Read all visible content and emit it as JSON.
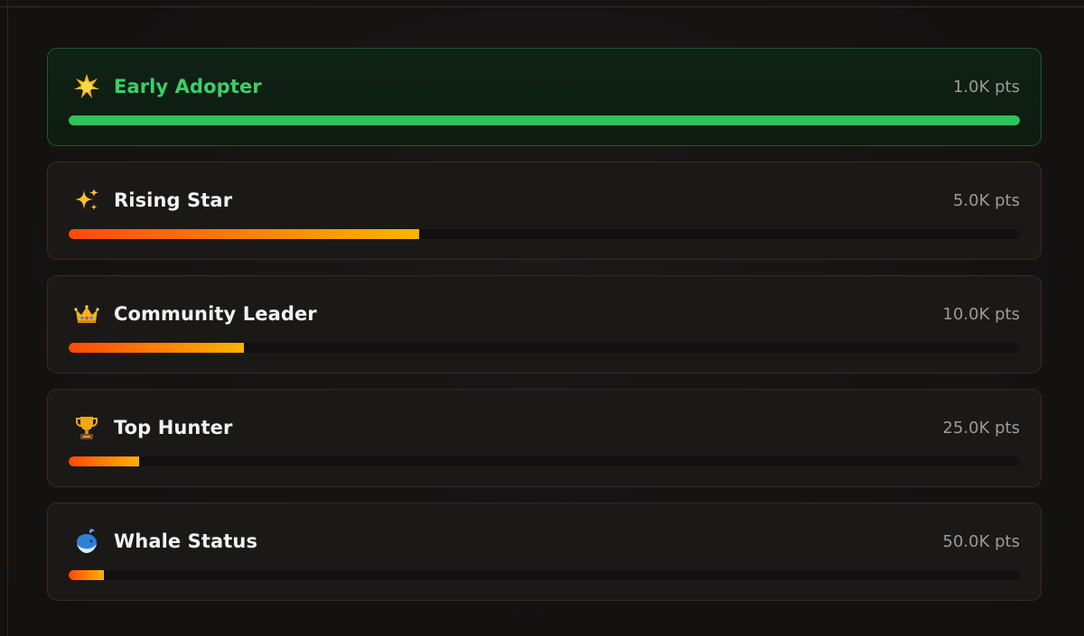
{
  "achievements": [
    {
      "title": "Early Adopter",
      "points": "1.0K pts",
      "progress_percent": 100,
      "icon": "glowing-star-icon",
      "completed": true
    },
    {
      "title": "Rising Star",
      "points": "5.0K pts",
      "progress_percent": 36.8,
      "icon": "sparkles-icon",
      "completed": false
    },
    {
      "title": "Community Leader",
      "points": "10.0K pts",
      "progress_percent": 18.4,
      "icon": "crown-icon",
      "completed": false
    },
    {
      "title": "Top Hunter",
      "points": "25.0K pts",
      "progress_percent": 7.4,
      "icon": "trophy-icon",
      "completed": false
    },
    {
      "title": "Whale Status",
      "points": "50.0K pts",
      "progress_percent": 3.7,
      "icon": "whale-icon",
      "completed": false
    }
  ],
  "colors": {
    "completed_accent": "#2ec45a",
    "progress_gradient_start": "#ff4a0a",
    "progress_gradient_end": "#ffb200",
    "background": "#151312"
  }
}
